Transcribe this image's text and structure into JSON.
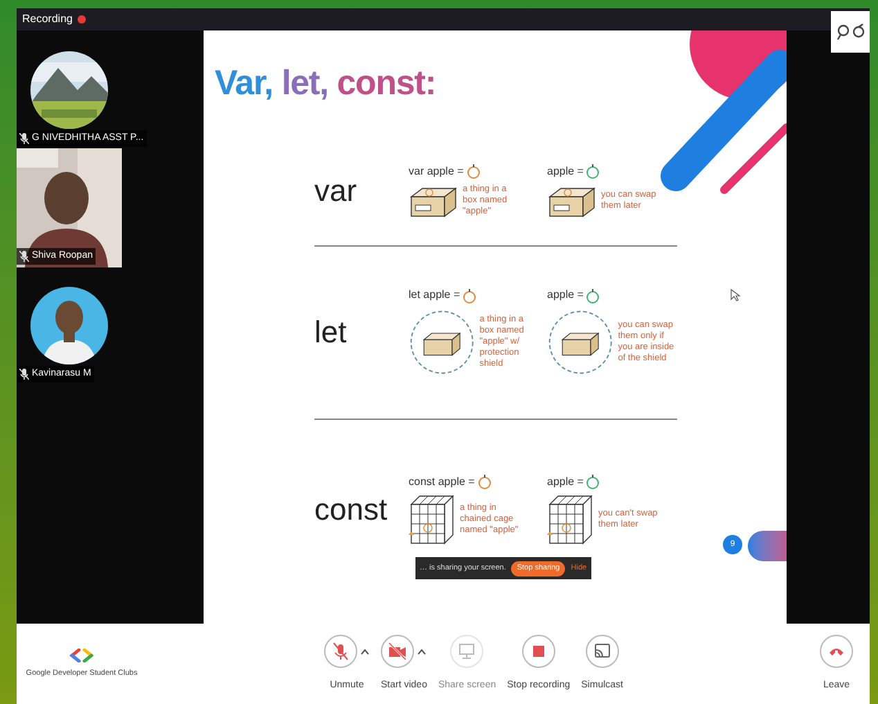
{
  "recording_bar": {
    "label": "Recording",
    "recording": true
  },
  "participants": [
    {
      "name": "G NIVEDHITHA ASST P...",
      "muted": true,
      "kind": "avatar"
    },
    {
      "name": "Shiva Roopan",
      "muted": true,
      "kind": "video"
    },
    {
      "name": "Kavinarasu M",
      "muted": true,
      "kind": "avatar"
    }
  ],
  "slide": {
    "title": "Var, let, const:",
    "rows": [
      {
        "keyword": "var",
        "items": [
          {
            "kind": "box",
            "code": "var apple =",
            "color": "#e08a3c",
            "note": "a thing in a box named \"apple\""
          },
          {
            "kind": "box",
            "code": "apple =",
            "color": "#3cb371",
            "note": "you can swap them later"
          }
        ]
      },
      {
        "keyword": "let",
        "items": [
          {
            "kind": "shield",
            "code": "let apple =",
            "color": "#e08a3c",
            "note": "a thing in a box named \"apple\" w/ protection shield"
          },
          {
            "kind": "shield",
            "code": "apple =",
            "color": "#3cb371",
            "note": "you can swap them only if you are inside of the shield"
          }
        ]
      },
      {
        "keyword": "const",
        "items": [
          {
            "kind": "cage",
            "code": "const apple =",
            "color": "#e08a3c",
            "note": "a thing in chained cage named \"apple\""
          },
          {
            "kind": "cage",
            "code": "apple =",
            "color": "#3cb371",
            "note": "you can't swap them later"
          }
        ]
      }
    ],
    "page_number": "9"
  },
  "share_banner": {
    "message": "… is sharing your screen.",
    "stop": "Stop sharing",
    "hide": "Hide"
  },
  "toolbar": {
    "brand": "Google Developer Student Clubs",
    "buttons": [
      {
        "label": "Unmute",
        "kind": "mic",
        "off": true,
        "menu": true,
        "disabled": false
      },
      {
        "label": "Start video",
        "kind": "video",
        "off": true,
        "menu": true,
        "disabled": false
      },
      {
        "label": "Share screen",
        "kind": "screen",
        "menu": false,
        "disabled": true
      },
      {
        "label": "Stop recording",
        "kind": "record",
        "menu": false,
        "disabled": false
      },
      {
        "label": "Simulcast",
        "kind": "cast",
        "menu": false,
        "disabled": false
      }
    ],
    "leave": "Leave"
  }
}
